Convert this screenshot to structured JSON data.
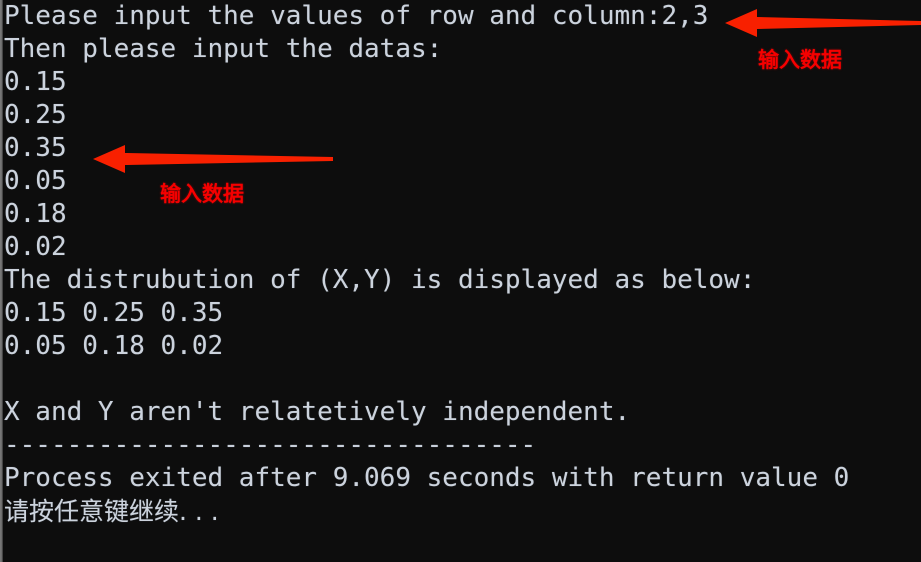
{
  "window": {
    "kind": "console-terminal",
    "background_color": "#0d0d0d",
    "text_color": "#ccd3dd",
    "annotation_color": "#f50000"
  },
  "console": {
    "lines": [
      {
        "id": "prompt-row-col",
        "text": "Please input the values of row and column:2,3"
      },
      {
        "id": "prompt-datas",
        "text": "Then please input the datas:"
      },
      {
        "id": "input-1",
        "text": "0.15"
      },
      {
        "id": "input-2",
        "text": "0.25"
      },
      {
        "id": "input-3",
        "text": "0.35"
      },
      {
        "id": "input-4",
        "text": "0.05"
      },
      {
        "id": "input-5",
        "text": "0.18"
      },
      {
        "id": "input-6",
        "text": "0.02"
      },
      {
        "id": "dist-header",
        "text": "The distrubution of (X,Y) is displayed as below:"
      },
      {
        "id": "matrix-row-1",
        "text": "0.15 0.25 0.35"
      },
      {
        "id": "matrix-row-2",
        "text": "0.05 0.18 0.02"
      },
      {
        "id": "blank-1",
        "text": " "
      },
      {
        "id": "conclusion",
        "text": "X and Y aren't relatetively independent."
      },
      {
        "id": "separator",
        "text": "----------------------------------"
      },
      {
        "id": "process-exit",
        "text": "Process exited after 9.069 seconds with return value 0"
      },
      {
        "id": "press-any-key",
        "text": "请按任意键继续. . ."
      }
    ]
  },
  "program": {
    "rows": 2,
    "columns": 3,
    "entered_values": [
      "0.15",
      "0.25",
      "0.35",
      "0.05",
      "0.18",
      "0.02"
    ],
    "distribution_matrix": [
      [
        "0.15",
        "0.25",
        "0.35"
      ],
      [
        "0.05",
        "0.18",
        "0.02"
      ]
    ],
    "independence_result": "X and Y aren't relatetively independent.",
    "exit_seconds": "9.069",
    "return_value": "0"
  },
  "annotations": [
    {
      "id": "annotation-top",
      "label": "输入数据",
      "points_at": "Please input the values of row and column:2,3",
      "arrow_direction": "left"
    },
    {
      "id": "annotation-middle",
      "label": "输入数据",
      "points_at": "0.35",
      "arrow_direction": "left"
    }
  ]
}
